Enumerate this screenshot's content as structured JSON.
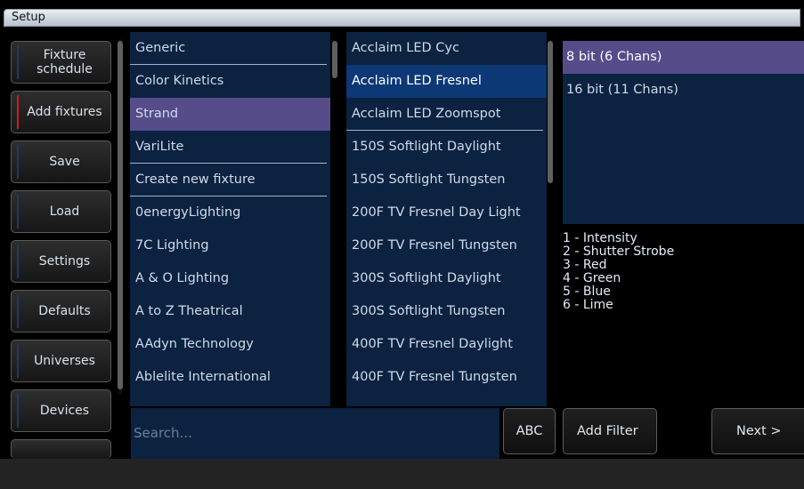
{
  "window": {
    "title": "Setup"
  },
  "nav": [
    {
      "label": "Fixture schedule",
      "active": false
    },
    {
      "label": "Add fixtures",
      "active": true
    },
    {
      "label": "Save",
      "active": false
    },
    {
      "label": "Load",
      "active": false
    },
    {
      "label": "Settings",
      "active": false
    },
    {
      "label": "Defaults",
      "active": false
    },
    {
      "label": "Universes",
      "active": false
    },
    {
      "label": "Devices",
      "active": false
    }
  ],
  "manufacturers": [
    "Generic",
    "Color Kinetics",
    "Strand",
    "VariLite",
    "Create new fixture",
    "0energyLighting",
    "7C Lighting",
    "A & O Lighting",
    "A to Z Theatrical",
    "AAdyn Technology",
    "Ablelite International"
  ],
  "manufacturer_selected": "Strand",
  "fixtures": [
    "Acclaim LED Cyc",
    "Acclaim LED Fresnel",
    "Acclaim LED Zoomspot",
    "150S Softlight Daylight",
    "150S Softlight Tungsten",
    "200F TV Fresnel Day Light",
    "200F TV Fresnel Tungsten",
    "300S Softlight Daylight",
    "300S Softlight Tungsten",
    "400F TV Fresnel Daylight",
    "400F TV Fresnel Tungsten"
  ],
  "fixture_selected": "Acclaim LED Fresnel",
  "modes": [
    "8 bit (6 Chans)",
    "16 bit (11 Chans)"
  ],
  "mode_selected": "8 bit (6 Chans)",
  "channels": [
    "1 - Intensity",
    "2 - Shutter Strobe",
    "3 - Red",
    "4 - Green",
    "5 - Blue",
    "6 - Lime"
  ],
  "search": {
    "placeholder": "Search..."
  },
  "buttons": {
    "abc": "ABC",
    "add_filter": "Add Filter",
    "next": "Next >"
  },
  "colors": {
    "list_bg": "#0b2240",
    "selection_purple": "#564c8a",
    "selection_blue": "#0c3875",
    "active_marker": "#d21c1c"
  }
}
